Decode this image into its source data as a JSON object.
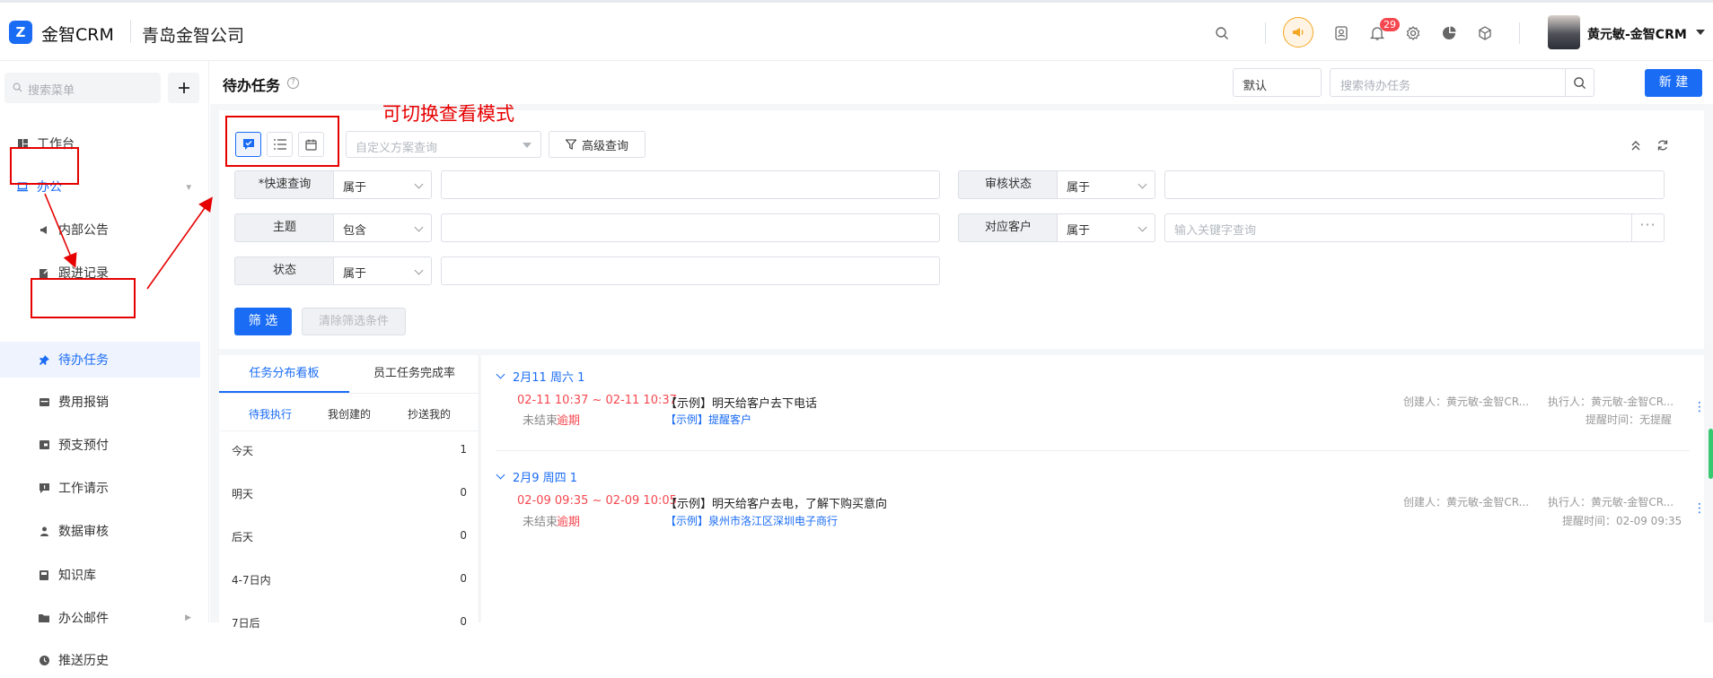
{
  "header": {
    "logo_letter": "Z",
    "brand": "金智CRM",
    "company": "青岛金智公司",
    "notification_count": "29",
    "user_name": "黄元敏-金智CRM",
    "accent_color": "#1a6cf5",
    "icons": [
      "search-icon",
      "megaphone-icon",
      "contacts-icon",
      "bell-icon",
      "gear-icon",
      "pie-chart-icon",
      "box-icon"
    ]
  },
  "sidebar": {
    "search_placeholder": "搜索菜单",
    "add_label": "+",
    "items": [
      {
        "label": "工作台",
        "icon": "dashboard-icon"
      },
      {
        "label": "办公",
        "icon": "laptop-icon"
      },
      {
        "label": "内部公告",
        "icon": "megaphone-icon"
      },
      {
        "label": "跟进记录",
        "icon": "edit-icon"
      },
      {
        "label": "待办任务",
        "icon": "pin-icon"
      },
      {
        "label": "费用报销",
        "icon": "card-icon"
      },
      {
        "label": "预支预付",
        "icon": "wallet-icon"
      },
      {
        "label": "工作请示",
        "icon": "chat-icon"
      },
      {
        "label": "数据审核",
        "icon": "user-check-icon"
      },
      {
        "label": "知识库",
        "icon": "book-icon"
      },
      {
        "label": "办公邮件",
        "icon": "folder-icon"
      },
      {
        "label": "推送历史",
        "icon": "clock-icon"
      }
    ]
  },
  "page": {
    "title": "待办任务",
    "help": "?",
    "view_select": "默认",
    "search_placeholder": "搜索待办任务",
    "new_button": "新 建"
  },
  "filter": {
    "scheme_placeholder": "自定义方案查询",
    "advanced_label": "高级查询",
    "rows": [
      {
        "label": "*快速查询",
        "op": "属于",
        "value_placeholder": ""
      },
      {
        "label": "主题",
        "op": "包含",
        "value_placeholder": ""
      },
      {
        "label": "状态",
        "op": "属于",
        "value_placeholder": ""
      },
      {
        "label": "审核状态",
        "op": "属于",
        "value_placeholder": ""
      },
      {
        "label": "对应客户",
        "op": "属于",
        "value_placeholder": "输入关键字查询"
      }
    ],
    "more_label": "···",
    "filter_button": "筛 选",
    "clear_button": "清除筛选条件"
  },
  "left_panel": {
    "tabs": [
      "任务分布看板",
      "员工任务完成率"
    ],
    "subtabs": [
      "待我执行",
      "我创建的",
      "抄送我的"
    ],
    "rows": [
      {
        "label": "今天",
        "count": "1"
      },
      {
        "label": "明天",
        "count": "0"
      },
      {
        "label": "后天",
        "count": "0"
      },
      {
        "label": "4-7日内",
        "count": "0"
      },
      {
        "label": "7日后",
        "count": "0"
      }
    ]
  },
  "task_groups": [
    {
      "header": "2月11  周六  1",
      "task": {
        "time": "02-11 10:37 ~ 02-11 10:37",
        "status": "未结束",
        "overdue": "逾期",
        "subject": "【示例】明天给客户去下电话",
        "client": "【示例】提醒客户",
        "creator": "创建人：黄元敏-金智CR...",
        "executor": "执行人：黄元敏-金智CR...",
        "reminder": "提醒时间：无提醒",
        "more": "⋮"
      }
    },
    {
      "header": "2月9  周四  1",
      "task": {
        "time": "02-09 09:35 ~ 02-09 10:05",
        "status": "未结束",
        "overdue": "逾期",
        "subject": "【示例】明天给客户去电，了解下购买意向",
        "client": "【示例】泉州市洛江区深圳电子商行",
        "creator": "创建人：黄元敏-金智CR...",
        "executor": "执行人：黄元敏-金智CR...",
        "reminder": "提醒时间：02-09 09:35",
        "more": "⋮"
      }
    }
  ],
  "annotation": {
    "text": "可切换查看模式",
    "color": "#e60000"
  }
}
